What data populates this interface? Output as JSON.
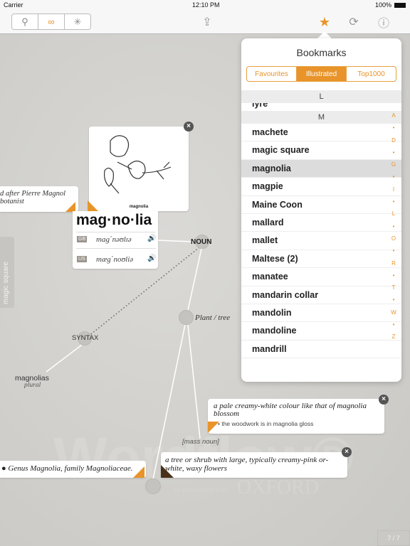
{
  "status": {
    "carrier": "Carrier",
    "time": "12:10 PM",
    "battery": "100%"
  },
  "toolbar": {
    "segments": [
      "search-icon",
      "wordweb-icon",
      "explore-icon"
    ],
    "active_segment": 1,
    "accent": "#e8942a"
  },
  "canvas": {
    "watermark": "Wordflow®",
    "watermark_sub": "in association with",
    "watermark_brand": "OXFORD",
    "side_tab": "magic square",
    "image_caption": "magnolia",
    "headword": "mag·no·lia",
    "pron": [
      {
        "region": "GB",
        "ipa": "mag΄nəʊlɪə"
      },
      {
        "region": "US",
        "ipa": "mæg΄noʊliə"
      }
    ],
    "etymology": "d after Pierre Magnol botanist",
    "nodes": {
      "noun": "NOUN",
      "plant": "Plant / tree",
      "syntax": "SYNTAX",
      "plural_word": "magnolias",
      "plural_label": "plural",
      "mass": "[mass noun]"
    },
    "def1": {
      "text": "a pale creamy-white colour like that of magnolia blossom",
      "example": "the woodwork is in magnolia gloss"
    },
    "def2": {
      "text": "a tree or shrub with large, typically creamy-pink or-white, waxy flowers"
    },
    "def3": {
      "text": "Genus Magnolia, family Magnoliaceae."
    },
    "page": "7 / 7"
  },
  "bookmarks": {
    "title": "Bookmarks",
    "tabs": [
      "Favourites",
      "Illustrated",
      "Top1000"
    ],
    "active_tab": 1,
    "sections": [
      {
        "letter": "L",
        "items": [
          "lyre"
        ]
      },
      {
        "letter": "M",
        "items": [
          "machete",
          "magic square",
          "magnolia",
          "magpie",
          "Maine Coon",
          "mallard",
          "mallet",
          "Maltese (2)",
          "manatee",
          "mandarin collar",
          "mandolin",
          "mandoline",
          "mandrill"
        ]
      }
    ],
    "selected": "magnolia",
    "index": [
      "A",
      "•",
      "D",
      "•",
      "G",
      "•",
      "I",
      "•",
      "L",
      "•",
      "O",
      "•",
      "R",
      "•",
      "T",
      "•",
      "W",
      "•",
      "Z"
    ]
  }
}
